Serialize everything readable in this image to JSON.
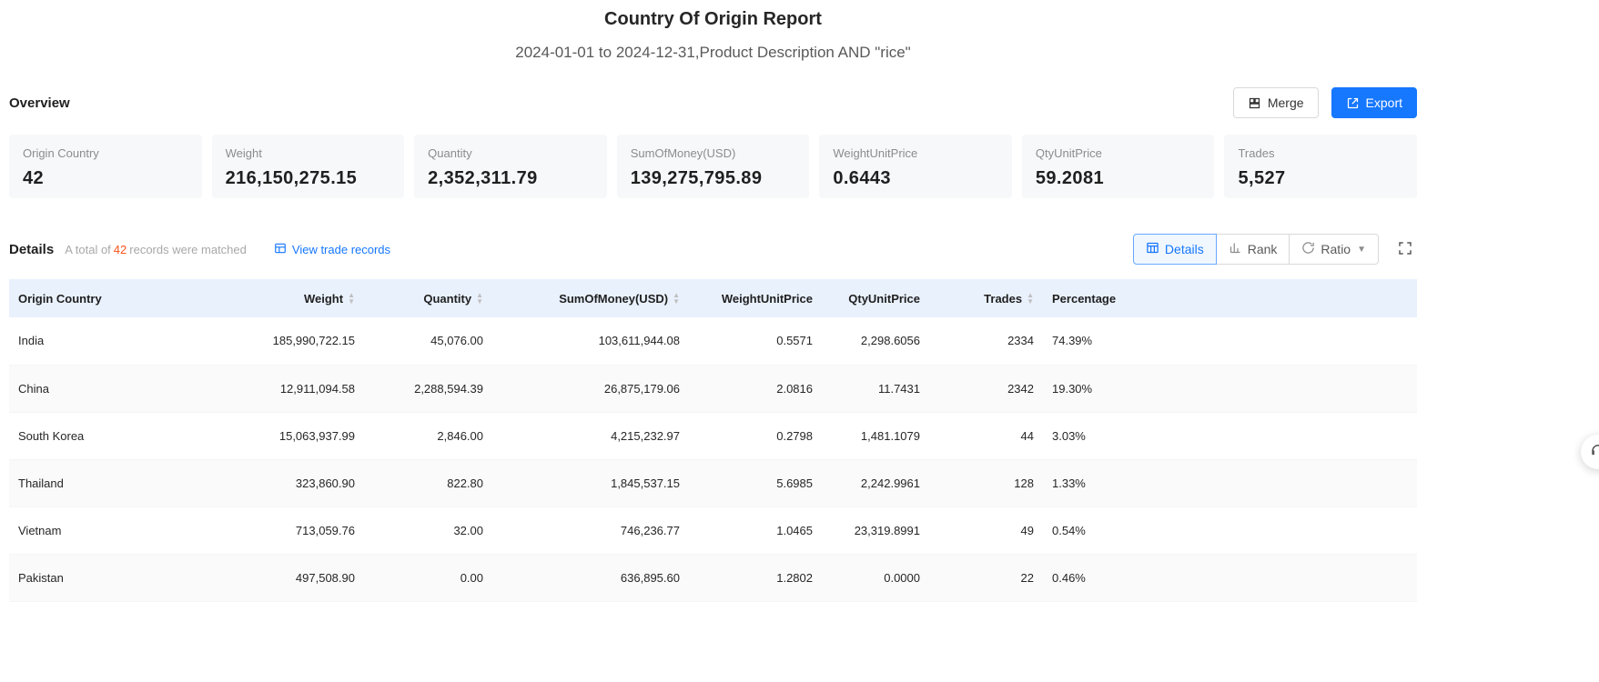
{
  "header": {
    "title": "Country Of Origin Report",
    "subtitle": "2024-01-01 to 2024-12-31,Product Description AND \"rice\""
  },
  "overview": {
    "section_label": "Overview",
    "merge_button": "Merge",
    "export_button": "Export",
    "cards": [
      {
        "label": "Origin Country",
        "value": "42"
      },
      {
        "label": "Weight",
        "value": "216,150,275.15"
      },
      {
        "label": "Quantity",
        "value": "2,352,311.79"
      },
      {
        "label": "SumOfMoney(USD)",
        "value": "139,275,795.89"
      },
      {
        "label": "WeightUnitPrice",
        "value": "0.6443"
      },
      {
        "label": "QtyUnitPrice",
        "value": "59.2081"
      },
      {
        "label": "Trades",
        "value": "5,527"
      }
    ]
  },
  "details": {
    "section_label": "Details",
    "match_prefix": "A total of",
    "match_count": "42",
    "match_suffix": "records were matched",
    "view_link": "View trade records",
    "tab_details": "Details",
    "tab_rank": "Rank",
    "tab_ratio": "Ratio"
  },
  "table": {
    "headers": {
      "origin_country": "Origin Country",
      "weight": "Weight",
      "quantity": "Quantity",
      "sum_of_money": "SumOfMoney(USD)",
      "weight_unit_price": "WeightUnitPrice",
      "qty_unit_price": "QtyUnitPrice",
      "trades": "Trades",
      "percentage": "Percentage"
    },
    "rows": [
      {
        "origin_country": "India",
        "weight": "185,990,722.15",
        "quantity": "45,076.00",
        "sum_of_money": "103,611,944.08",
        "weight_unit_price": "0.5571",
        "qty_unit_price": "2,298.6056",
        "trades": "2334",
        "percentage": "74.39%"
      },
      {
        "origin_country": "China",
        "weight": "12,911,094.58",
        "quantity": "2,288,594.39",
        "sum_of_money": "26,875,179.06",
        "weight_unit_price": "2.0816",
        "qty_unit_price": "11.7431",
        "trades": "2342",
        "percentage": "19.30%"
      },
      {
        "origin_country": "South Korea",
        "weight": "15,063,937.99",
        "quantity": "2,846.00",
        "sum_of_money": "4,215,232.97",
        "weight_unit_price": "0.2798",
        "qty_unit_price": "1,481.1079",
        "trades": "44",
        "percentage": "3.03%"
      },
      {
        "origin_country": "Thailand",
        "weight": "323,860.90",
        "quantity": "822.80",
        "sum_of_money": "1,845,537.15",
        "weight_unit_price": "5.6985",
        "qty_unit_price": "2,242.9961",
        "trades": "128",
        "percentage": "1.33%"
      },
      {
        "origin_country": "Vietnam",
        "weight": "713,059.76",
        "quantity": "32.00",
        "sum_of_money": "746,236.77",
        "weight_unit_price": "1.0465",
        "qty_unit_price": "23,319.8991",
        "trades": "49",
        "percentage": "0.54%"
      },
      {
        "origin_country": "Pakistan",
        "weight": "497,508.90",
        "quantity": "0.00",
        "sum_of_money": "636,895.60",
        "weight_unit_price": "1.2802",
        "qty_unit_price": "0.0000",
        "trades": "22",
        "percentage": "0.46%"
      }
    ]
  },
  "colors": {
    "accent": "#1677ff",
    "table_header_bg": "#e9f1fd",
    "match_count": "#fa541c",
    "card_bg": "#f7f8fa"
  }
}
